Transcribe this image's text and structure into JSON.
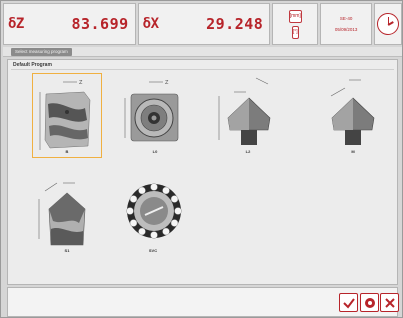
{
  "header": {
    "z_label": "δZ",
    "z_value": "83.699",
    "x_label": "δX",
    "x_value": "29.248",
    "units_top": "[mm]",
    "units_bottom": "[°]",
    "info_top": "SE-40",
    "info_bottom": "05/09/2013"
  },
  "toolbar": {
    "tab_label": "Select measuring program"
  },
  "panel": {
    "title": "Default Program",
    "tiles": [
      {
        "label": "B"
      },
      {
        "label": "L0"
      },
      {
        "label": "L2"
      },
      {
        "label": "M"
      },
      {
        "label": "S1"
      },
      {
        "label": "SVC"
      }
    ]
  },
  "footer": {
    "ok_icon": "check-icon",
    "tool_icon": "tool-icon",
    "cancel_icon": "cross-icon"
  },
  "colors": {
    "accent": "#b7242a",
    "selected_border": "#f0b041"
  }
}
